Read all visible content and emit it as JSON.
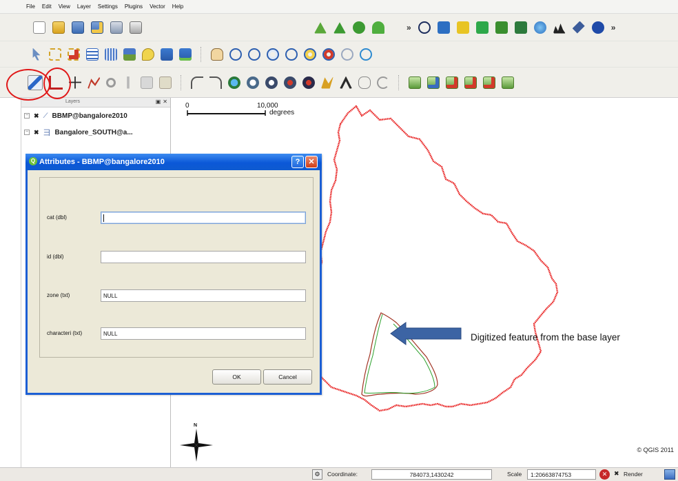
{
  "menu": [
    "File",
    "Edit",
    "View",
    "Layer",
    "Settings",
    "Plugins",
    "Vector",
    "Help"
  ],
  "toolbars": {
    "row1_icons": [
      "new-project-icon",
      "open-project-icon",
      "save-project-icon",
      "save-as-icon",
      "print-composer-icon",
      "print-icon"
    ],
    "row1_right_icons": [
      "add-vector-layer-icon",
      "add-raster-layer-icon",
      "add-postgis-layer-icon",
      "add-spatialite-layer-icon"
    ],
    "row1_far_icons": [
      "copyright-label-icon",
      "scale-bar-icon",
      "grid-icon",
      "north-arrow-icon",
      "gps-icon",
      "capture-icon",
      "globe-icon",
      "profile-icon",
      "satellite-icon",
      "navigation-icon"
    ],
    "row2_icons": [
      "identify-icon",
      "select-icon",
      "deselect-icon",
      "attribute-table-icon",
      "measure-line-icon",
      "measure-area-icon",
      "annotation-icon",
      "label-icon",
      "label-move-icon",
      "pan-icon",
      "zoom-in-icon",
      "zoom-out-icon",
      "zoom-full-icon",
      "zoom-layer-icon",
      "zoom-selection-icon",
      "zoom-last-icon",
      "zoom-next-icon",
      "refresh-icon"
    ],
    "row3_icons": [
      "toggle-editing-icon",
      "capture-line-icon",
      "move-feature-icon",
      "node-tool-icon",
      "delete-selected-icon",
      "cut-features-icon",
      "copy-features-icon",
      "paste-features-icon",
      "undo-icon",
      "redo-icon",
      "simplify-feature-icon",
      "add-ring-icon",
      "add-part-icon",
      "delete-ring-icon",
      "delete-part-icon",
      "reshape-features-icon",
      "split-features-icon",
      "merge-features-icon",
      "rotate-point-symbols-icon",
      "grass-tools-1-icon",
      "grass-tools-2-icon",
      "grass-tools-3-icon",
      "grass-tools-4-icon",
      "grass-tools-5-icon",
      "grass-tools-6-icon"
    ],
    "more_glyph": "»"
  },
  "layers_panel": {
    "title": "Layers",
    "layers": [
      {
        "name": "BBMP@bangalore2010"
      },
      {
        "name": "Bangalore_SOUTH@a..."
      }
    ]
  },
  "dialog": {
    "title": "Attributes - BBMP@bangalore2010",
    "fields": [
      {
        "label": "cat (dbl)",
        "value": ""
      },
      {
        "label": "id (dbl)",
        "value": ""
      },
      {
        "label": "zone (txt)",
        "value": "NULL"
      },
      {
        "label": "characteri (txt)",
        "value": "NULL"
      }
    ],
    "ok_label": "OK",
    "cancel_label": "Cancel",
    "help_glyph": "?",
    "close_glyph": "✕"
  },
  "map": {
    "scale_start": "0",
    "scale_end": "10,000",
    "scale_unit": "degrees",
    "north_label": "N",
    "annotation": "Digitized feature from the base layer",
    "copyright": "© QGIS 2011",
    "boundary_color": "#e81c1c",
    "feature_color_1": "#a03020",
    "feature_color_2": "#2aa02a",
    "arrow_color": "#3c64a4"
  },
  "status": {
    "coordinate_label": "Coordinate:",
    "coordinate_value": "784073,1430242",
    "scale_label": "Scale",
    "scale_value": "1:20663874753",
    "render_label": "Render"
  },
  "colors": {
    "highlight_ring": "#e01818",
    "dialog_title": "#0b58d8"
  }
}
